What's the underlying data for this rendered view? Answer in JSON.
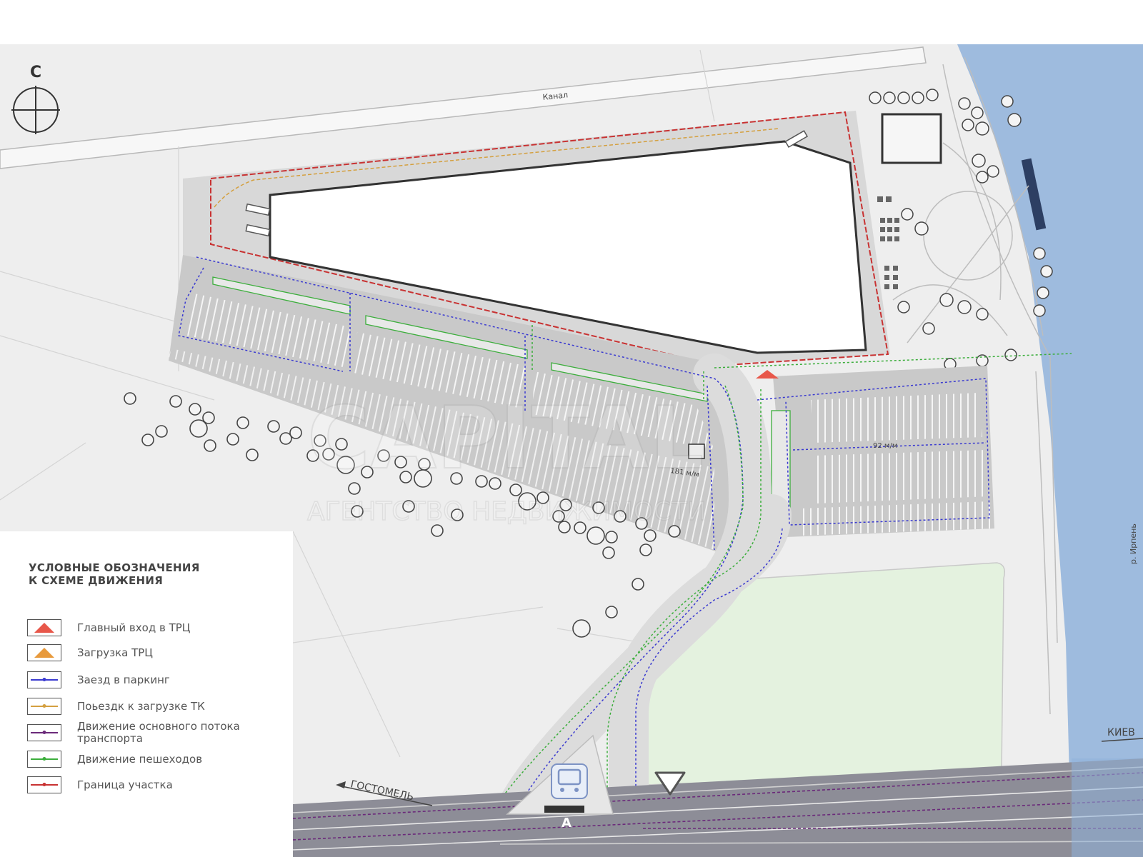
{
  "compass": {
    "letter": "С"
  },
  "labels": {
    "canal": "Канал",
    "parking_left": "181 м/м",
    "parking_right": "92 м/м",
    "road_left": "ГОСТОМЕЛЬ",
    "road_right": "КИЕВ",
    "river": "р. Ирпень",
    "bus_stop_letter": "А"
  },
  "watermark": {
    "line1": "CAPITAL",
    "line2": "АГЕНТСТВО НЕДВИЖИМОСТИ"
  },
  "legend": {
    "title_line1": "УСЛОВНЫЕ ОБОЗНАЧЕНИЯ",
    "title_line2": "К СХЕМЕ ДВИЖЕНИЯ",
    "items": [
      {
        "label": "Главный вход в ТРЦ",
        "kind": "triangle",
        "color": "#e8574a"
      },
      {
        "label": "Загрузка ТРЦ",
        "kind": "triangle",
        "color": "#e89a3c"
      },
      {
        "label": "Заезд в паркинг",
        "kind": "line",
        "color": "#3a3ad0"
      },
      {
        "label": "Поьездк к загрузке ТК",
        "kind": "line",
        "color": "#d4a040"
      },
      {
        "label": "Движение основного потока транспорта",
        "kind": "line",
        "color": "#6b2a7a"
      },
      {
        "label": "Движение пешеходов",
        "kind": "line",
        "color": "#3cae3c"
      },
      {
        "label": "Граница участка",
        "kind": "line",
        "color": "#c83232"
      }
    ]
  },
  "colors": {
    "ground": "#efefef",
    "road": "#dcdcdc",
    "parking": "#c9c9c9",
    "building": "#ffffff",
    "river": "#8fb2da",
    "lawn": "#e4f2df",
    "highway": "#8d8d97",
    "boundary": "#c83232",
    "parking_route": "#3a3ad0",
    "pedestrian": "#3cae3c",
    "main_traffic": "#6b2a7a",
    "loading_route": "#d4a040"
  }
}
